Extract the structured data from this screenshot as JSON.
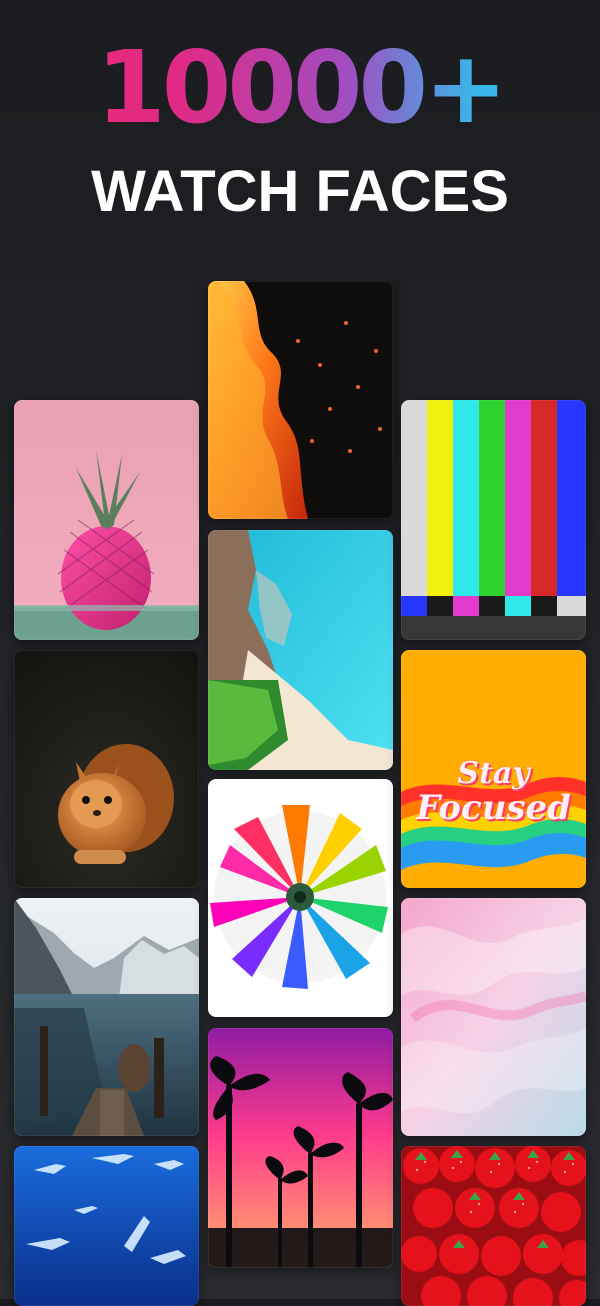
{
  "header": {
    "headline": "10000+",
    "subheadline": "WATCH FACES"
  },
  "tiles": {
    "col1": [
      "pineapple",
      "squirrel",
      "mountain lake dock",
      "sharks underwater"
    ],
    "col2": [
      "fire",
      "beach from above",
      "rainbow flower",
      "palm trees sunset"
    ],
    "col3": [
      "tv color bars",
      "stay focused rainbow",
      "pink blue marble",
      "strawberries"
    ]
  },
  "stickers": {
    "stay": "Stay",
    "focused": "Focused"
  },
  "colors": {
    "background_top": "#1a1c1f",
    "background_bottom": "#2a2c30",
    "headline_gradient_start": "#ef2c73",
    "headline_gradient_end": "#15d2ee",
    "subhead": "#ffffff"
  }
}
